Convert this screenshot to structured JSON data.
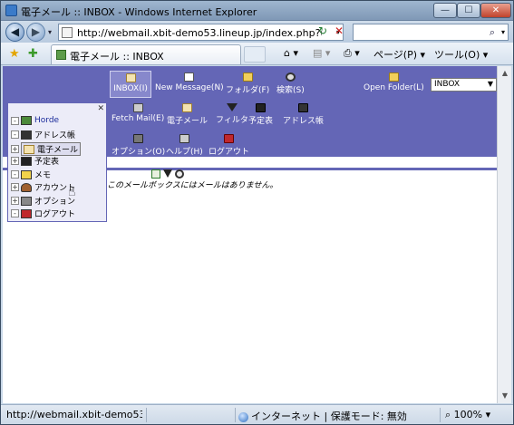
{
  "window": {
    "title": "電子メール :: INBOX - Windows Internet Explorer",
    "minimize_glyph": "—",
    "maximize_glyph": "☐",
    "close_glyph": "✕"
  },
  "address_bar": {
    "back_glyph": "◀",
    "forward_glyph": "▶",
    "url": "http://webmail.xbit-demo53.lineup.jp/index.php?url=http%",
    "refresh_glyph": "↻",
    "stop_glyph": "✕",
    "search_value": "",
    "search_glyph": "⌕"
  },
  "command_bar": {
    "tab_title": "電子メール :: INBOX",
    "home_glyph": "⌂ ▾",
    "feed_glyph": "▤ ▾",
    "print_glyph": "⎙ ▾",
    "page_menu": "ページ(P) ▾",
    "tools_menu": "ツール(O) ▾"
  },
  "horde_nav": {
    "inbox": "INBOX(I)",
    "new_message": "New Message(N)",
    "folders": "フォルダ(F)",
    "search": "検索(S)",
    "open_folder": "Open Folder(L)",
    "folder_select_value": "INBOX",
    "fetch_mail": "Fetch Mail(E)",
    "mail": "電子メール",
    "filter": "フィルタ",
    "calendar": "予定表",
    "address_book": "アドレス帳",
    "options": "オプション(O)",
    "help": "ヘルプ(H)",
    "logout": "ログアウト"
  },
  "mailbox": {
    "empty_message": "このメールボックスにはメールはありません。"
  },
  "sidebar": {
    "close_glyph": "✕",
    "items": [
      {
        "label": "Horde",
        "exp": "-"
      },
      {
        "label": "アドレス帳",
        "exp": "-"
      },
      {
        "label": "電子メール",
        "exp": "+"
      },
      {
        "label": "予定表",
        "exp": "+"
      },
      {
        "label": "メモ",
        "exp": "-"
      },
      {
        "label": "アカウント",
        "exp": "+"
      },
      {
        "label": "オプション",
        "exp": "+"
      },
      {
        "label": "ログアウト",
        "exp": "-"
      }
    ]
  },
  "status_bar": {
    "url": "http://webmail.xbit-demo53.lineup",
    "zone": "インターネット | 保護モード: 無効",
    "zoom": "100%"
  },
  "colors": {
    "horde_header": "#6466b6",
    "sidebar_bg": "#ececf8"
  }
}
